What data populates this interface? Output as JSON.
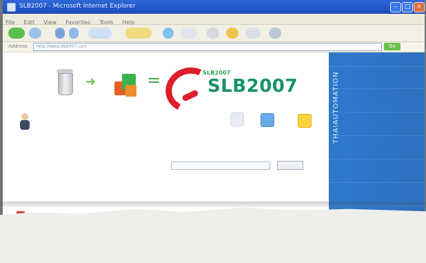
{
  "window": {
    "title": "SLB2007 - Microsoft Internet Explorer",
    "menu": [
      "File",
      "Edit",
      "View",
      "Favorites",
      "Tools",
      "Help"
    ],
    "address_label": "Address",
    "address": "http://www.slb2007.com",
    "go_label": "Go"
  },
  "header": {
    "brand_top": "SLB2007",
    "brand_main": "SLB2007"
  },
  "user": {
    "title": "",
    "lines": [
      "",
      ""
    ]
  },
  "quick_links": [
    {
      "label": ""
    },
    {
      "label": ""
    },
    {
      "label": ""
    }
  ],
  "sections": {
    "left_title": "",
    "left_subtitle": "",
    "search_title": "",
    "search_placeholder": "",
    "search_button": "",
    "hint_title": "",
    "hint_links": [
      "",
      ""
    ],
    "center_title": "",
    "alert_text": "",
    "note_text": ""
  },
  "table": {
    "columns": [
      "",
      "",
      "",
      "",
      "",
      "",
      ""
    ],
    "row": [
      "",
      "",
      "",
      "",
      "",
      "",
      ""
    ]
  },
  "right_panel": {
    "vertical_text": "THAIAUTOMATION"
  },
  "colors": {
    "title_blue": "#2356c8",
    "panel_blue": "#2f78ce",
    "brand_green": "#17926c",
    "brand_red": "#dc1f2a"
  }
}
